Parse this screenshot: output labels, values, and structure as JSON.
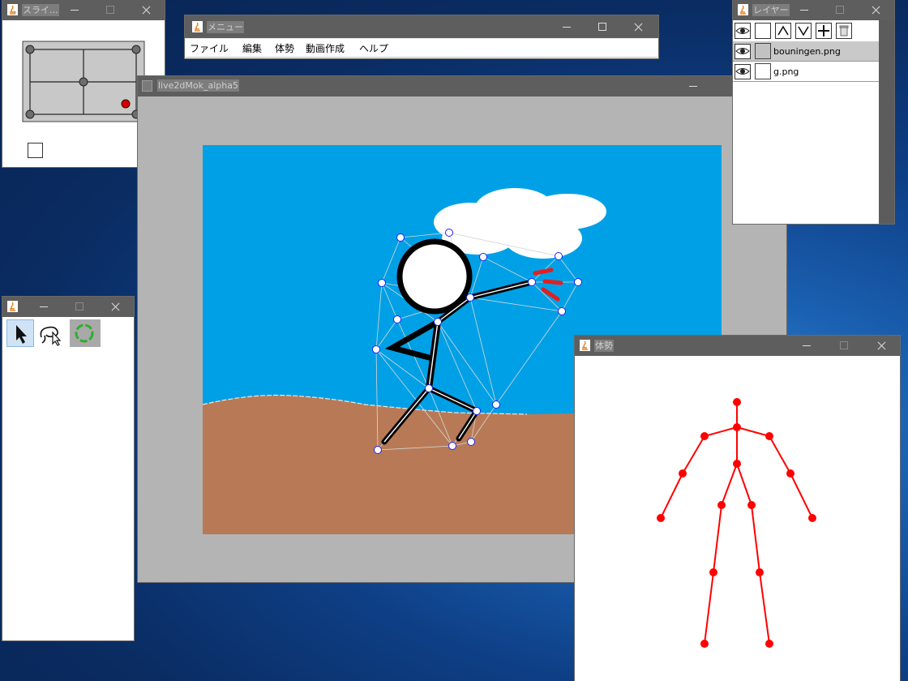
{
  "windows": {
    "slider": {
      "title": "スライ..."
    },
    "menu": {
      "title": "メニュー",
      "items": [
        "ファイル",
        "編集",
        "体勢",
        "動画作成",
        "ヘルプ"
      ]
    },
    "main": {
      "title": "live2dMok_alpha5"
    },
    "layer": {
      "title": "レイヤー",
      "tools": [
        "eye-icon",
        "layer-icon",
        "up-icon",
        "down-icon",
        "add-icon",
        "trash-icon"
      ],
      "layers": [
        {
          "name": "bouninge­n.png",
          "display": "bouningen.png",
          "selected": true
        },
        {
          "name": "g.png",
          "display": "g.png",
          "selected": false
        }
      ]
    },
    "tools": {
      "title": "",
      "items": [
        "pointer-tool-icon",
        "lasso-tool-icon",
        "rotate-tool-icon"
      ]
    },
    "pose": {
      "title": "体勢"
    }
  },
  "colors": {
    "sky": "#00a0e6",
    "ground": "#b87a56",
    "canvas_bg": "#b4b4b4",
    "pose_joint": "#ff0000",
    "mesh_point": "#2020ff"
  }
}
